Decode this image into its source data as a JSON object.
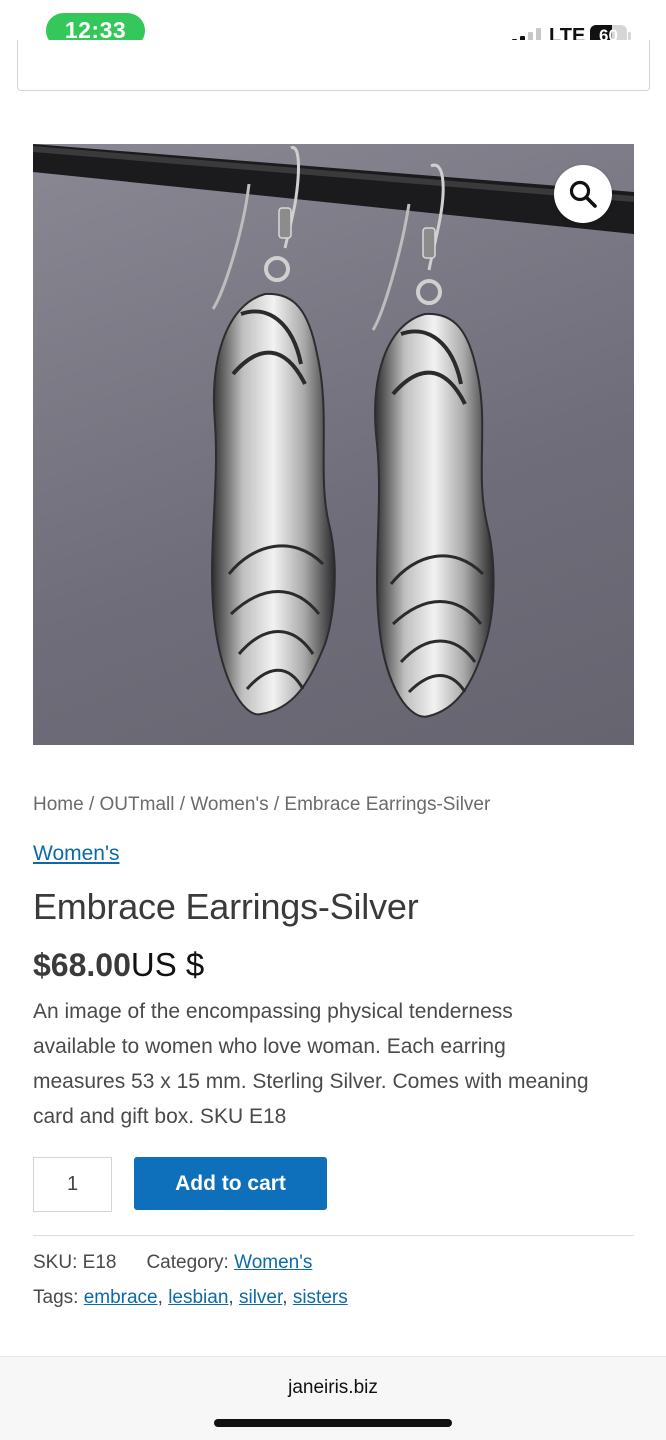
{
  "status_bar": {
    "time": "12:33",
    "network": "LTE",
    "battery": "60",
    "battery_level": 0.6
  },
  "product": {
    "image_alt": "Embrace Earrings-Silver",
    "zoom_icon": "search-icon",
    "breadcrumb": [
      "Home",
      "OUTmall",
      "Women's",
      "Embrace Earrings-Silver"
    ],
    "breadcrumb_separator": " / ",
    "category_link": "Women's",
    "title": "Embrace Earrings-Silver",
    "price": "$68.00",
    "currency": "US $",
    "description": "An image of the encompassing physical tenderness available to women who love woman. Each earring measures 53 x 15 mm. Sterling Silver. Comes with meaning card and gift box. SKU E18",
    "quantity": "1",
    "add_to_cart": "Add to cart",
    "sku_label": "SKU:",
    "sku": "E18",
    "category_label": "Category:",
    "category": "Women's",
    "tags_label": "Tags:",
    "tags": [
      "embrace",
      "lesbian",
      "silver",
      "sisters"
    ]
  },
  "browser": {
    "url": "janeiris.biz"
  },
  "colors": {
    "accent": "#0e6fba",
    "link": "#0d6aa8",
    "status_green": "#34c759"
  }
}
